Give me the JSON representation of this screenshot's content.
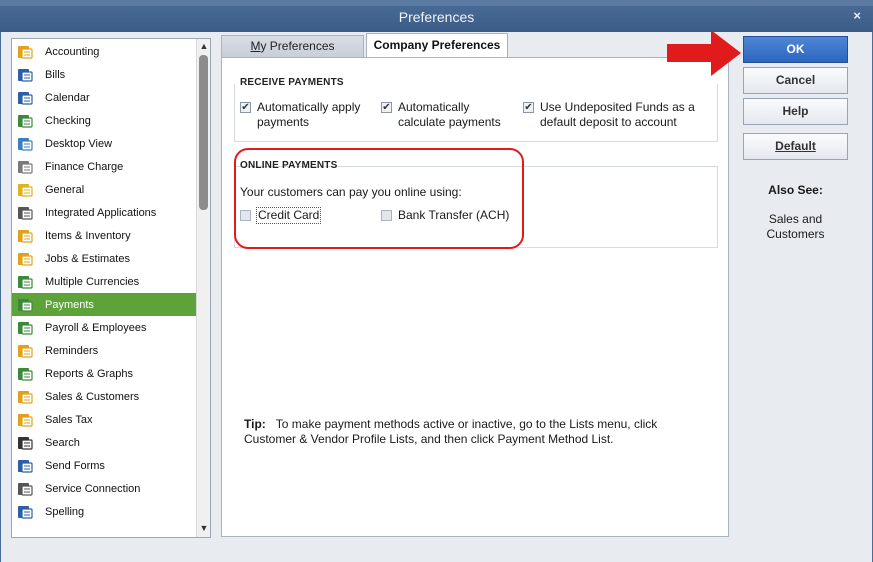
{
  "window": {
    "title": "Preferences",
    "close": "×"
  },
  "sidebar": {
    "items": [
      {
        "label": "Accounting",
        "icon": "accounting-icon"
      },
      {
        "label": "Bills",
        "icon": "bills-icon"
      },
      {
        "label": "Calendar",
        "icon": "calendar-icon"
      },
      {
        "label": "Checking",
        "icon": "checking-icon"
      },
      {
        "label": "Desktop View",
        "icon": "desktop-view-icon"
      },
      {
        "label": "Finance Charge",
        "icon": "finance-charge-icon"
      },
      {
        "label": "General",
        "icon": "general-icon"
      },
      {
        "label": "Integrated Applications",
        "icon": "integrated-applications-icon"
      },
      {
        "label": "Items & Inventory",
        "icon": "items-inventory-icon"
      },
      {
        "label": "Jobs & Estimates",
        "icon": "jobs-estimates-icon"
      },
      {
        "label": "Multiple Currencies",
        "icon": "multiple-currencies-icon"
      },
      {
        "label": "Payments",
        "icon": "payments-icon"
      },
      {
        "label": "Payroll & Employees",
        "icon": "payroll-employees-icon"
      },
      {
        "label": "Reminders",
        "icon": "reminders-icon"
      },
      {
        "label": "Reports & Graphs",
        "icon": "reports-graphs-icon"
      },
      {
        "label": "Sales & Customers",
        "icon": "sales-customers-icon"
      },
      {
        "label": "Sales Tax",
        "icon": "sales-tax-icon"
      },
      {
        "label": "Search",
        "icon": "search-icon"
      },
      {
        "label": "Send Forms",
        "icon": "send-forms-icon"
      },
      {
        "label": "Service Connection",
        "icon": "service-connection-icon"
      },
      {
        "label": "Spelling",
        "icon": "spelling-icon"
      }
    ],
    "selected": "Payments",
    "selected_color": "#5ea33a"
  },
  "tabs": {
    "my_prefix": "M",
    "my_rest": "y Preferences",
    "company": "Company Preferences"
  },
  "receive_payments": {
    "title": "RECEIVE PAYMENTS",
    "apply_1": "Automatically apply",
    "apply_2": "payments",
    "calc_1": "Automatically",
    "calc_2": "calculate payments",
    "undep_1": "Use Undeposited Funds as a",
    "undep_2": "default deposit to account",
    "check": "✔"
  },
  "online_payments": {
    "title": "ONLINE PAYMENTS",
    "intro": "Your customers can pay you online using:",
    "credit_card": "Credit Card",
    "bank_transfer": "Bank Transfer (ACH)"
  },
  "tip": {
    "label": "Tip:",
    "text": "To make payment methods active or inactive, go to the Lists menu, click Customer & Vendor Profile Lists, and then click Payment Method List."
  },
  "buttons": {
    "ok": "OK",
    "cancel": "Cancel",
    "help": "Help",
    "default": "Default"
  },
  "also_see": {
    "heading": "Also See:",
    "link_1": "Sales and",
    "link_2": "Customers"
  },
  "colors": {
    "annotation_red": "#e11b1b",
    "ok_blue": "#2c66c0"
  }
}
